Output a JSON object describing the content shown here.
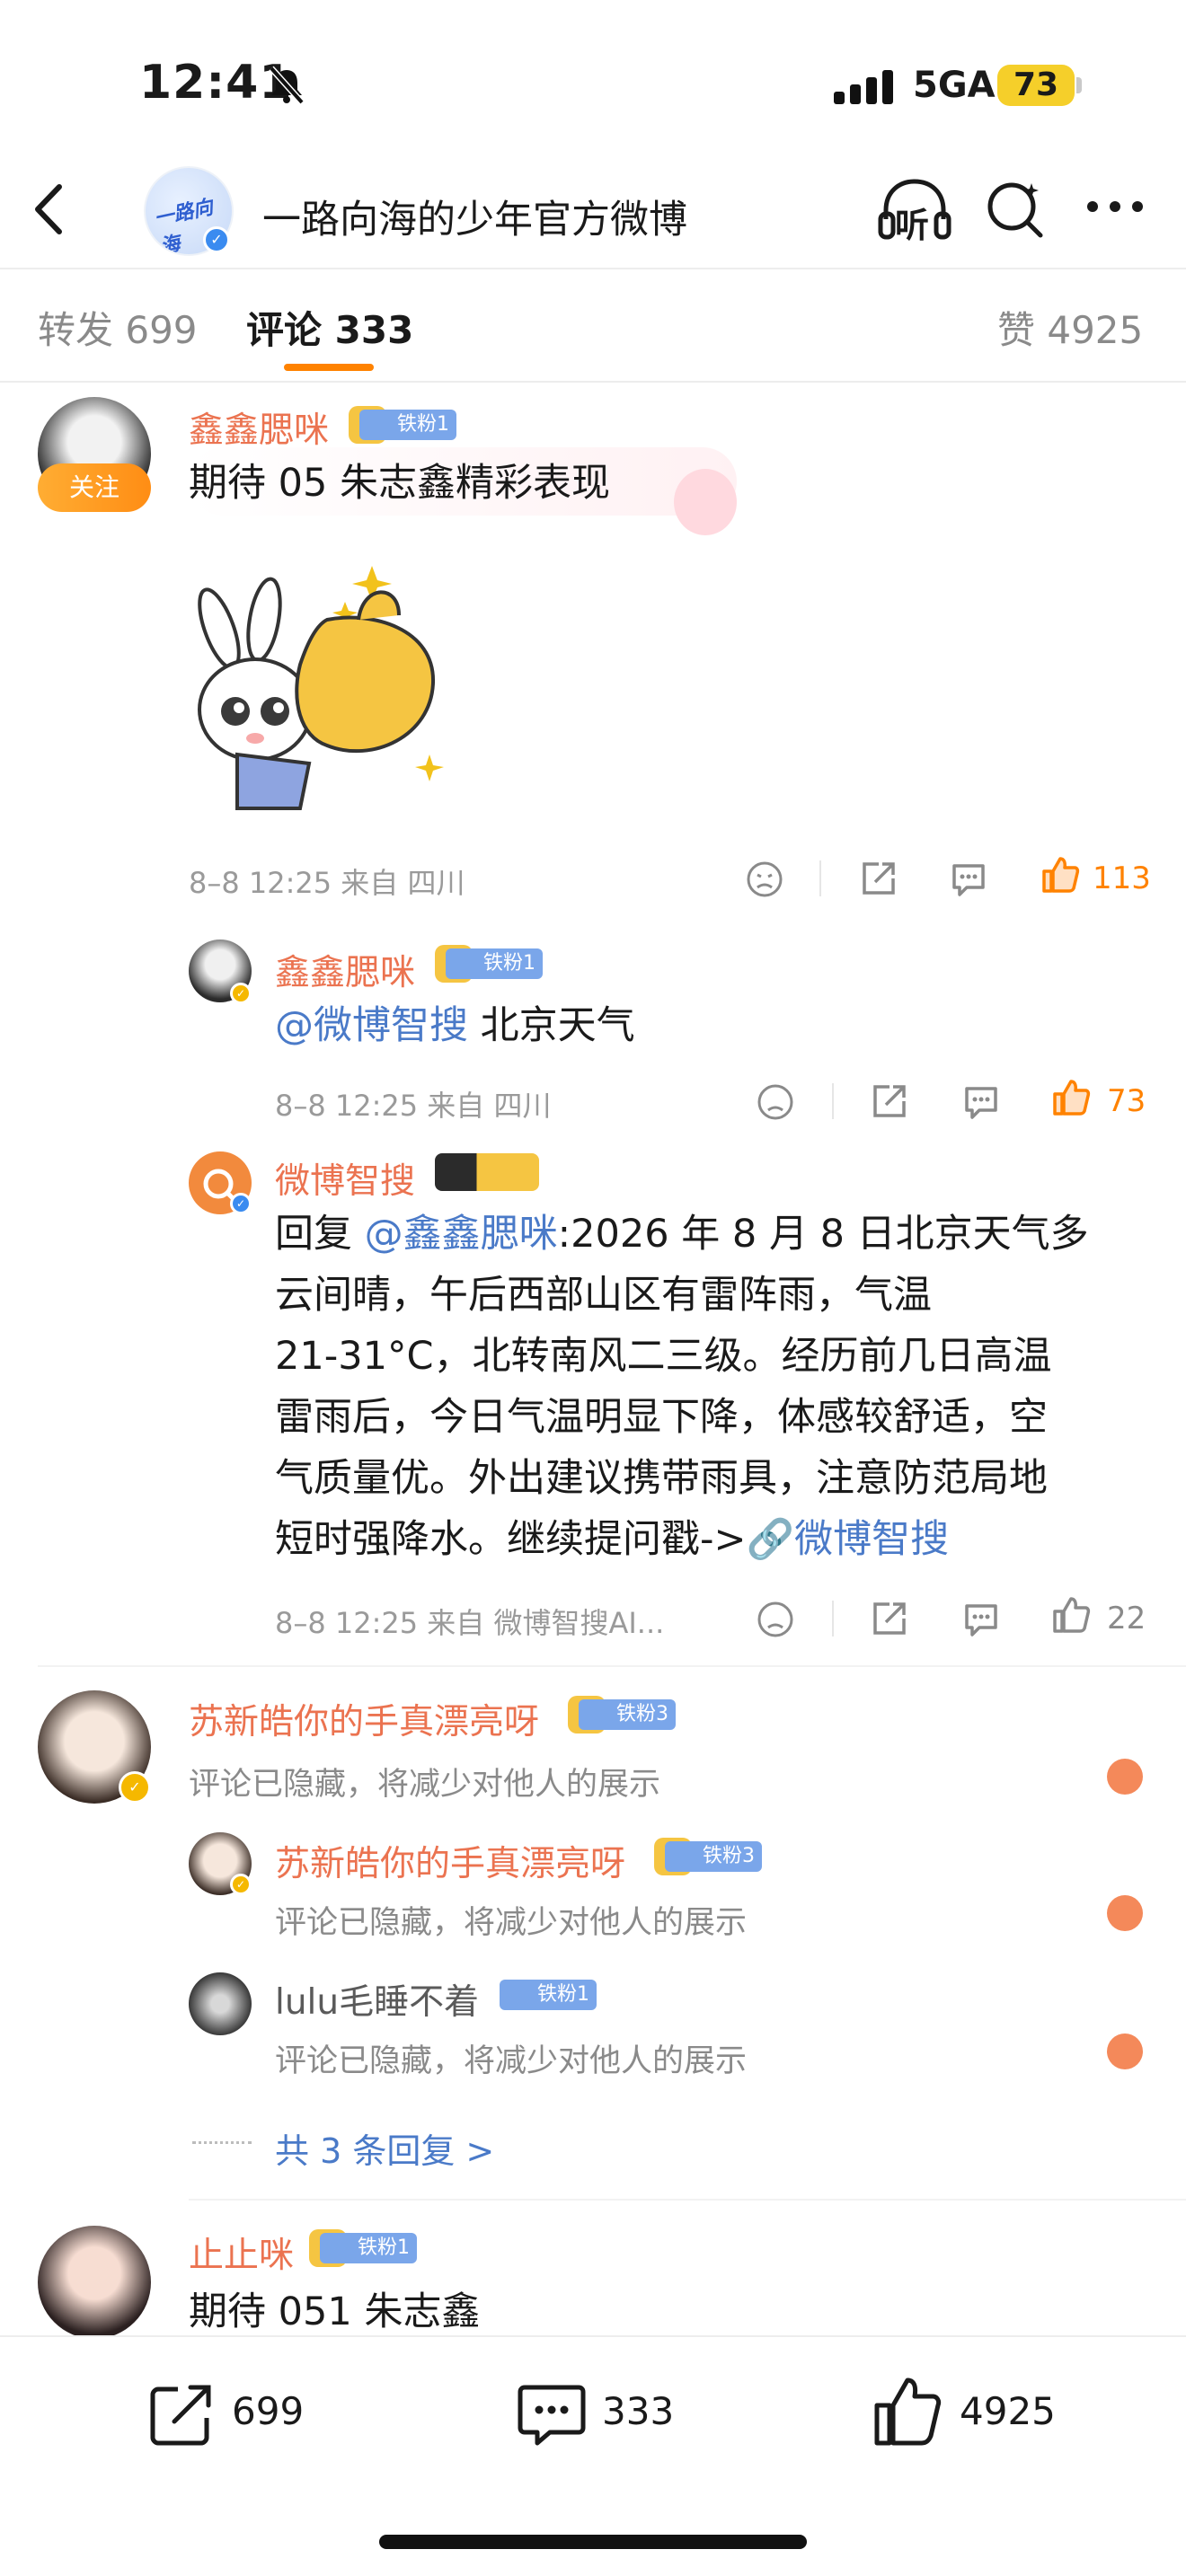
{
  "status_bar": {
    "time": "12:41",
    "network": "5GA",
    "battery": "73",
    "icons": [
      "bell-slash-icon",
      "signal-icon"
    ]
  },
  "header": {
    "title": "一路向海的少年官方微博",
    "icons": [
      "back-icon",
      "listen-icon",
      "search-icon",
      "more-icon"
    ],
    "listen_label": "听"
  },
  "tabs": {
    "repost": "转发 699",
    "comment": "评论 333",
    "like": "赞 4925"
  },
  "comments": [
    {
      "user": "鑫鑫腮咪",
      "badge": "铁粉1",
      "follow_label": "关注",
      "text": "期待 05 朱志鑫精彩表现",
      "meta": "8–8 12:25  来自 四川",
      "likes": "113",
      "replies": [
        {
          "user": "鑫鑫腮咪",
          "badge": "铁粉1",
          "mention": "@微博智搜",
          "text": " 北京天气",
          "meta": "8–8 12:25  来自 四川",
          "likes": "73"
        },
        {
          "user": "微博智搜",
          "reply_prefix": "回复 ",
          "mention": "@鑫鑫腮咪",
          "lines": [
            ":2026 年 8 月 8 日北京天气多",
            "云间晴，午后西部山区有雷阵雨，气温",
            "21-31°C，北转南风二三级。经历前几日高温",
            "雷雨后，今日气温明显下降，体感较舒适，空",
            "气质量优。外出建议携带雨具，注意防范局地"
          ],
          "last_line": "短时强降水。继续提问戳->",
          "link": "微博智搜",
          "meta": "8–8 12:25  来自 微博智搜AI...",
          "likes": "22"
        }
      ]
    },
    {
      "user": "苏新皓你的手真漂亮呀",
      "badge": "铁粉3",
      "text": "评论已隐藏，将减少对他人的展示",
      "replies": [
        {
          "user": "苏新皓你的手真漂亮呀",
          "badge": "铁粉3",
          "text": "评论已隐藏，将减少对他人的展示"
        },
        {
          "user": "lulu毛睡不着",
          "badge": "铁粉1",
          "text": "评论已隐藏，将减少对他人的展示"
        }
      ],
      "more_replies": "共 3 条回复 >"
    },
    {
      "user": "止止咪",
      "badge": "铁粉1",
      "text": "期待 051 朱志鑫"
    }
  ],
  "bottom_bar": {
    "repost": "699",
    "comment": "333",
    "like": "4925"
  },
  "colors": {
    "accent": "#ff8200",
    "username": "#eb7350",
    "link": "#4a7ac8",
    "fan_badge": "#7aa6ea"
  }
}
